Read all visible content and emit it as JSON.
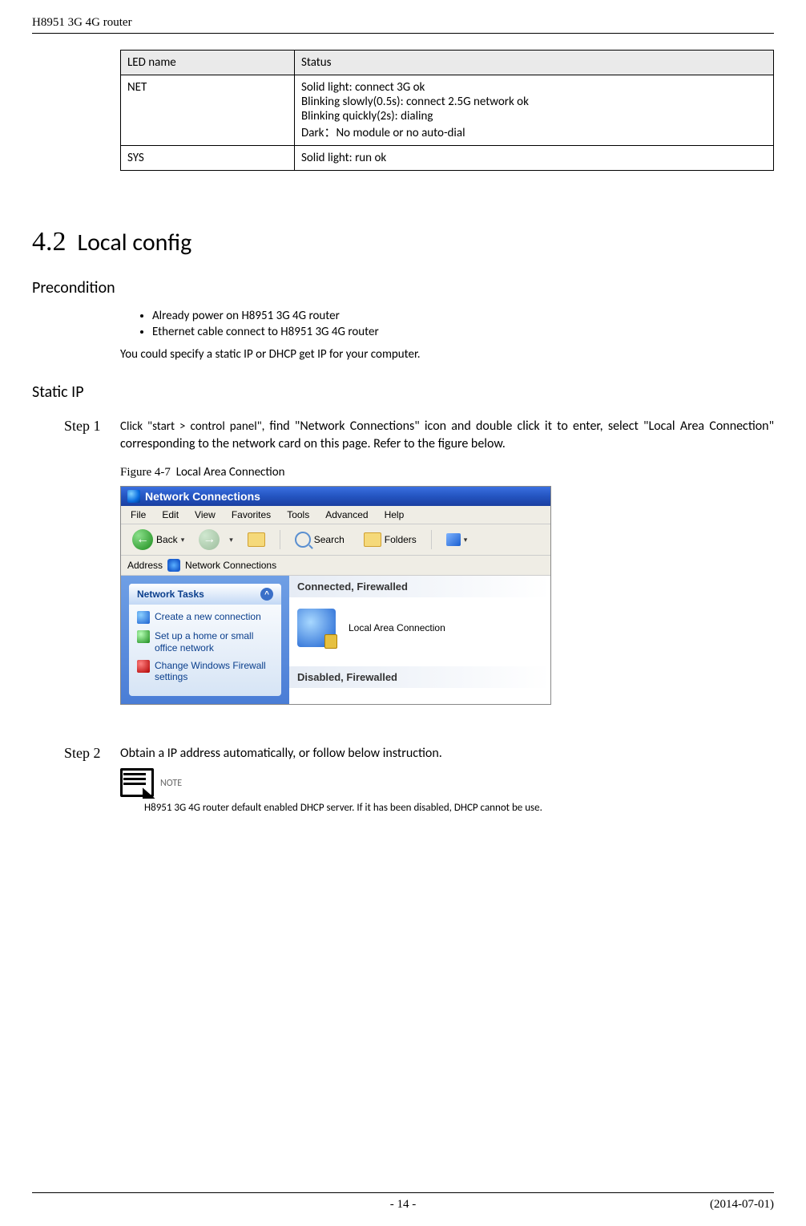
{
  "header": {
    "doc_title": "H8951 3G 4G router"
  },
  "led_table": {
    "head_col1": "LED name",
    "head_col2": "Status",
    "rows": [
      {
        "name": "NET",
        "status_lines": [
          "Solid light: connect 3G ok",
          "Blinking slowly(0.5s): connect 2.5G network ok",
          "Blinking quickly(2s): dialing",
          "Dark：No module or no auto-dial"
        ]
      },
      {
        "name": "SYS",
        "status_lines": [
          "Solid light: run ok"
        ]
      }
    ]
  },
  "section": {
    "num": "4.2",
    "title": "Local config"
  },
  "precondition": {
    "heading": "Precondition",
    "bullets": [
      "Already power on H8951 3G 4G router",
      "Ethernet cable connect to H8951 3G 4G router"
    ],
    "body": "You could specify a static IP or DHCP get IP for your computer."
  },
  "static_ip": {
    "heading": "Static IP",
    "step1_label": "Step 1",
    "step1_body_a": "Click \"start > control panel\", ",
    "step1_body_b": "find \"Network Connections\" icon and double click it to enter, select \"Local Area Connection\" corresponding to the network card on this page. Refer to the figure below.",
    "figure_label": "Figure 4-7",
    "figure_title": "Local Area Connection",
    "step2_label": "Step 2",
    "step2_body": "Obtain a IP address automatically, or follow below instruction.",
    "note_label": "NOTE",
    "note_text": "H8951 3G 4G router    default enabled DHCP server. If it has been disabled, DHCP cannot be use."
  },
  "screenshot": {
    "title": "Network Connections",
    "menus": [
      "File",
      "Edit",
      "View",
      "Favorites",
      "Tools",
      "Advanced",
      "Help"
    ],
    "toolbar": {
      "back": "Back",
      "search": "Search",
      "folders": "Folders"
    },
    "address_label": "Address",
    "address_value": "Network Connections",
    "tasks_head": "Network Tasks",
    "tasks": [
      "Create a new connection",
      "Set up a home or small office network",
      "Change Windows Firewall settings"
    ],
    "group1": "Connected, Firewalled",
    "lan_label": "Local Area Connection",
    "group2": "Disabled, Firewalled"
  },
  "footer": {
    "page": "- 14 -",
    "date": "(2014-07-01)"
  }
}
